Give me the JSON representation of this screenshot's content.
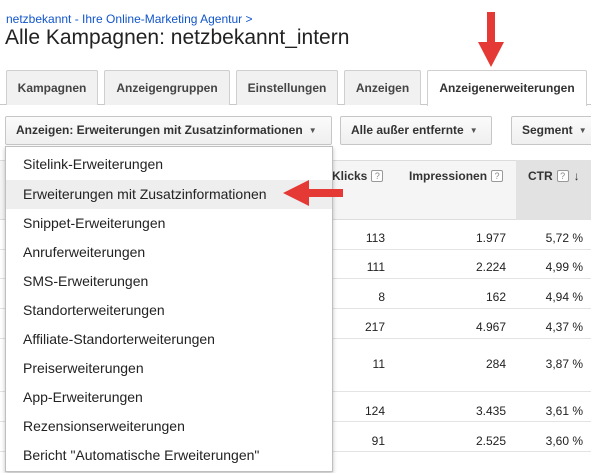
{
  "breadcrumb": "netzbekannt - Ihre Online-Marketing Agentur >",
  "title": "Alle Kampagnen: netzbekannt_intern",
  "tabs": [
    {
      "label": "Kampagnen",
      "active": false
    },
    {
      "label": "Anzeigengruppen",
      "active": false
    },
    {
      "label": "Einstellungen",
      "active": false
    },
    {
      "label": "Anzeigen",
      "active": false
    },
    {
      "label": "Anzeigenerweiterungen",
      "active": true
    }
  ],
  "toolbar": {
    "view_label": "Anzeigen: Erweiterungen mit Zusatzinformationen",
    "filter_label": "Alle außer entfernte",
    "segment_label": "Segment"
  },
  "table": {
    "headers": {
      "clicks": "Klicks",
      "impressions": "Impressionen",
      "ctr": "CTR"
    },
    "help_glyph": "?",
    "sort_glyph": "↓",
    "rows": [
      {
        "clicks": "113",
        "impressions": "1.977",
        "ctr": "5,72 %"
      },
      {
        "clicks": "111",
        "impressions": "2.224",
        "ctr": "4,99 %"
      },
      {
        "clicks": "8",
        "impressions": "162",
        "ctr": "4,94 %"
      },
      {
        "clicks": "217",
        "impressions": "4.967",
        "ctr": "4,37 %"
      },
      {
        "clicks": "11",
        "impressions": "284",
        "ctr": "3,87 %"
      },
      {
        "clicks": "124",
        "impressions": "3.435",
        "ctr": "3,61 %"
      },
      {
        "clicks": "91",
        "impressions": "2.525",
        "ctr": "3,60 %"
      }
    ]
  },
  "dropdown": {
    "items": [
      "Sitelink-Erweiterungen",
      "Erweiterungen mit Zusatzinformationen",
      "Snippet-Erweiterungen",
      "Anruferweiterungen",
      "SMS-Erweiterungen",
      "Standorterweiterungen",
      "Affiliate-Standorterweiterungen",
      "Preiserweiterungen",
      "App-Erweiterungen",
      "Rezensionserweiterungen",
      "Bericht \"Automatische Erweiterungen\""
    ],
    "selected_index": 1
  },
  "colors": {
    "link": "#1155cc",
    "annotation_arrow": "#e53935"
  },
  "icons": {
    "caret": "caret-down-icon",
    "annotation": "red-arrow-icon"
  }
}
